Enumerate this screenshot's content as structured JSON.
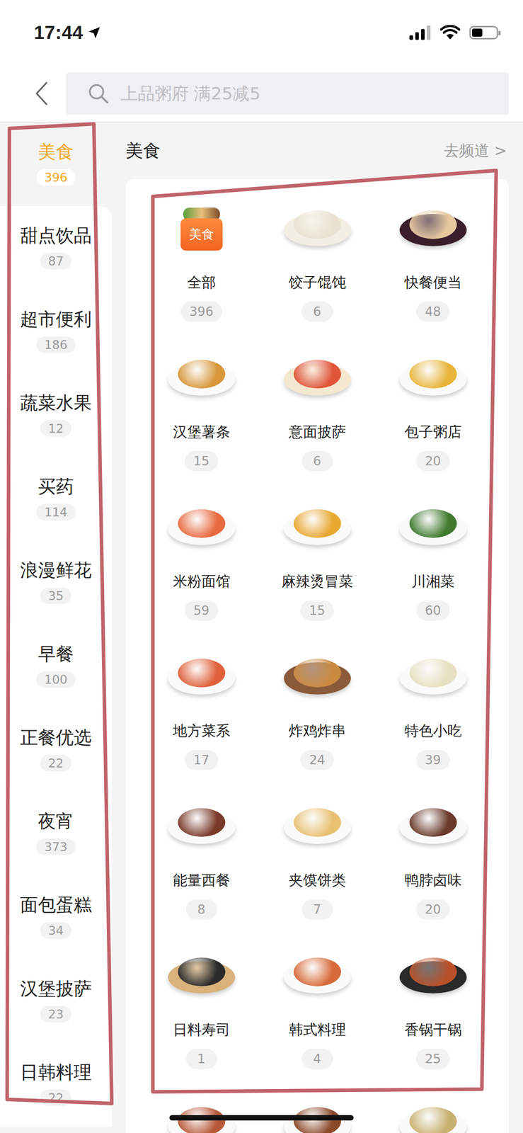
{
  "status_bar": {
    "time": "17:44",
    "battery_level": 0.45
  },
  "search": {
    "placeholder": "上品粥府 满25减5"
  },
  "sidebar": {
    "items": [
      {
        "label": "美食",
        "count": "396",
        "selected": true
      },
      {
        "label": "甜点饮品",
        "count": "87",
        "selected": false
      },
      {
        "label": "超市便利",
        "count": "186",
        "selected": false
      },
      {
        "label": "蔬菜水果",
        "count": "12",
        "selected": false
      },
      {
        "label": "买药",
        "count": "114",
        "selected": false
      },
      {
        "label": "浪漫鲜花",
        "count": "35",
        "selected": false
      },
      {
        "label": "早餐",
        "count": "100",
        "selected": false
      },
      {
        "label": "正餐优选",
        "count": "22",
        "selected": false
      },
      {
        "label": "夜宵",
        "count": "373",
        "selected": false
      },
      {
        "label": "面包蛋糕",
        "count": "34",
        "selected": false
      },
      {
        "label": "汉堡披萨",
        "count": "23",
        "selected": false
      },
      {
        "label": "日韩料理",
        "count": "22",
        "selected": false
      }
    ]
  },
  "section": {
    "title": "美食",
    "link": "去频道 >"
  },
  "grid": {
    "items": [
      {
        "label": "全部",
        "count": "396",
        "icon_text": "美食"
      },
      {
        "label": "饺子馄饨",
        "count": "6"
      },
      {
        "label": "快餐便当",
        "count": "48"
      },
      {
        "label": "汉堡薯条",
        "count": "15"
      },
      {
        "label": "意面披萨",
        "count": "6"
      },
      {
        "label": "包子粥店",
        "count": "20"
      },
      {
        "label": "米粉面馆",
        "count": "59"
      },
      {
        "label": "麻辣烫冒菜",
        "count": "15"
      },
      {
        "label": "川湘菜",
        "count": "60"
      },
      {
        "label": "地方菜系",
        "count": "17"
      },
      {
        "label": "炸鸡炸串",
        "count": "24"
      },
      {
        "label": "特色小吃",
        "count": "39"
      },
      {
        "label": "能量西餐",
        "count": "8"
      },
      {
        "label": "夹馍饼类",
        "count": "7"
      },
      {
        "label": "鸭脖卤味",
        "count": "20"
      },
      {
        "label": "日料寿司",
        "count": "1"
      },
      {
        "label": "韩式料理",
        "count": "4"
      },
      {
        "label": "香锅干锅",
        "count": "25"
      }
    ]
  }
}
